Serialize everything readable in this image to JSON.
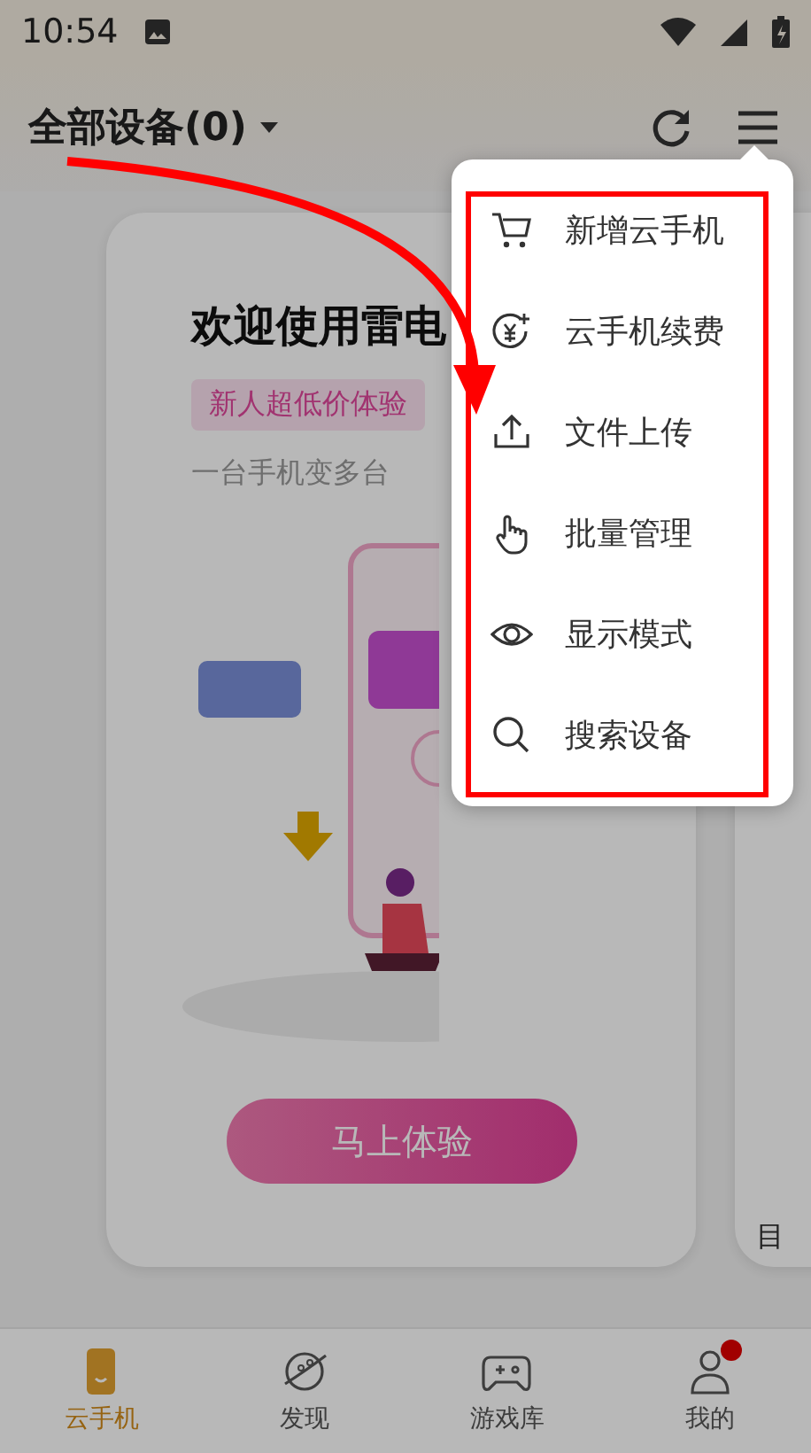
{
  "status_bar": {
    "time": "10:54"
  },
  "header": {
    "title": "全部设备(0)"
  },
  "card": {
    "title": "欢迎使用雷电",
    "promo": "新人超低价体验",
    "subtitle": "一台手机变多台",
    "button": "马上体验"
  },
  "next_card": {
    "text": "目"
  },
  "menu": {
    "items": [
      {
        "label": "新增云手机"
      },
      {
        "label": "云手机续费"
      },
      {
        "label": "文件上传"
      },
      {
        "label": "批量管理"
      },
      {
        "label": "显示模式"
      },
      {
        "label": "搜索设备"
      }
    ]
  },
  "bottom_nav": {
    "items": [
      {
        "label": "云手机",
        "selected": true,
        "badge": false
      },
      {
        "label": "发现",
        "selected": false,
        "badge": false
      },
      {
        "label": "游戏库",
        "selected": false,
        "badge": false
      },
      {
        "label": "我的",
        "selected": false,
        "badge": true
      }
    ]
  }
}
